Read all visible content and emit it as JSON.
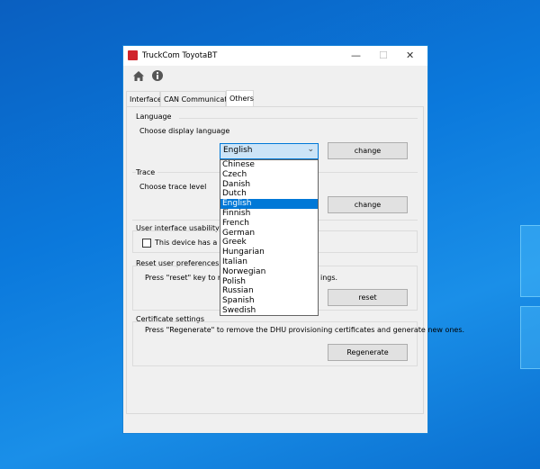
{
  "window": {
    "title": "TruckCom ToyotaBT",
    "minimize": "—",
    "maximize": "☐",
    "close": "✕"
  },
  "toolbar": {
    "icons": [
      "home-icon",
      "info-icon"
    ]
  },
  "tabs": [
    {
      "label": "Interface"
    },
    {
      "label": "CAN Communication"
    },
    {
      "label": "Others",
      "active": true
    }
  ],
  "language": {
    "title": "Language",
    "prompt": "Choose display language",
    "selected": "English",
    "button": "change",
    "options": [
      "Chinese",
      "Czech",
      "Danish",
      "Dutch",
      "English",
      "Finnish",
      "French",
      "German",
      "Greek",
      "Hungarian",
      "Italian",
      "Norwegian",
      "Polish",
      "Russian",
      "Spanish",
      "Swedish"
    ]
  },
  "trace": {
    "title": "Trace",
    "prompt": "Choose trace level",
    "button": "change"
  },
  "usability": {
    "title": "User interface usability",
    "checkbox_label": "This device has a touc",
    "checked": false
  },
  "reset": {
    "title": "Reset user preferences",
    "text_start": "Press \"reset\" key to retur",
    "text_end": "ings.",
    "button": "reset"
  },
  "certificate": {
    "title": "Certificate settings",
    "text": "Press \"Regenerate\" to remove the DHU provisioning certificates and generate new ones.",
    "button": "Regenerate"
  },
  "colors": {
    "accent": "#0078d7",
    "desktop": "#0b79dc"
  }
}
